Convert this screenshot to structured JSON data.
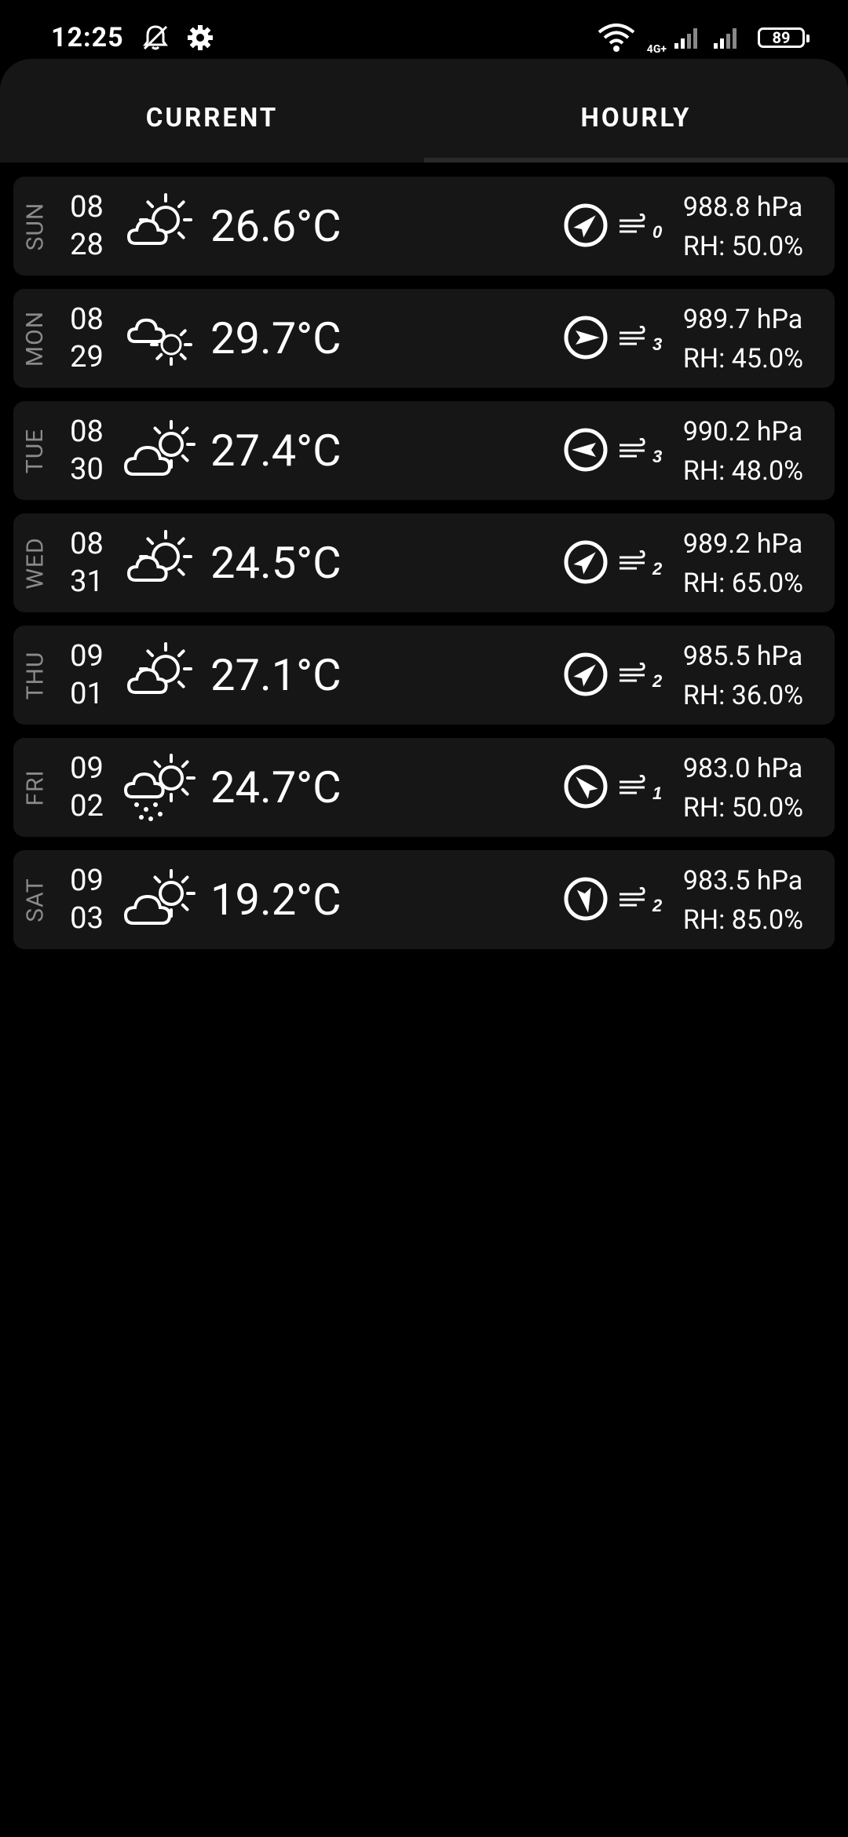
{
  "status_bar": {
    "time": "12:25",
    "network_type": "4G+",
    "battery_level": "89"
  },
  "tabs": [
    {
      "label": "CURRENT"
    },
    {
      "label": "HOURLY"
    }
  ],
  "forecast": [
    {
      "day": "SUN",
      "month": "08",
      "date": "28",
      "weather_icon": "partly-cloudy-sun-icon",
      "temp": "26.6°C",
      "wind_dir_deg": 45,
      "wind_speed": "0",
      "pressure": "988.8 hPa",
      "humidity": "RH: 50.0%"
    },
    {
      "day": "MON",
      "month": "08",
      "date": "29",
      "weather_icon": "cloud-sun-behind-icon",
      "temp": "29.7°C",
      "wind_dir_deg": 90,
      "wind_speed": "3",
      "pressure": "989.7 hPa",
      "humidity": "RH: 45.0%"
    },
    {
      "day": "TUE",
      "month": "08",
      "date": "30",
      "weather_icon": "cloud-sun-icon",
      "temp": "27.4°C",
      "wind_dir_deg": 270,
      "wind_speed": "3",
      "pressure": "990.2 hPa",
      "humidity": "RH: 48.0%"
    },
    {
      "day": "WED",
      "month": "08",
      "date": "31",
      "weather_icon": "partly-cloudy-sun-icon",
      "temp": "24.5°C",
      "wind_dir_deg": 45,
      "wind_speed": "2",
      "pressure": "989.2 hPa",
      "humidity": "RH: 65.0%"
    },
    {
      "day": "THU",
      "month": "09",
      "date": "01",
      "weather_icon": "partly-cloudy-sun-icon",
      "temp": "27.1°C",
      "wind_dir_deg": 45,
      "wind_speed": "2",
      "pressure": "985.5 hPa",
      "humidity": "RH: 36.0%"
    },
    {
      "day": "FRI",
      "month": "09",
      "date": "02",
      "weather_icon": "rain-cloud-sun-icon",
      "temp": "24.7°C",
      "wind_dir_deg": 315,
      "wind_speed": "1",
      "pressure": "983.0 hPa",
      "humidity": "RH: 50.0%"
    },
    {
      "day": "SAT",
      "month": "09",
      "date": "03",
      "weather_icon": "cloud-sun-icon",
      "temp": "19.2°C",
      "wind_dir_deg": 170,
      "wind_speed": "2",
      "pressure": "983.5 hPa",
      "humidity": "RH: 85.0%"
    }
  ]
}
